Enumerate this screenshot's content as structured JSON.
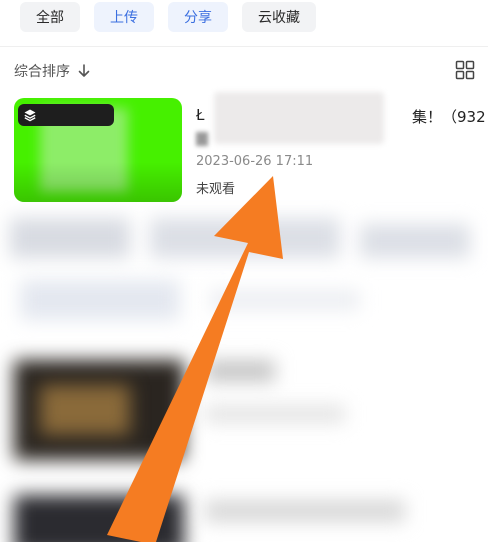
{
  "filters": [
    {
      "label": "全部",
      "active": false
    },
    {
      "label": "上传",
      "active": true
    },
    {
      "label": "分享",
      "active": true
    },
    {
      "label": "云收藏",
      "active": false
    }
  ],
  "sort": {
    "label": "综合排序"
  },
  "item": {
    "title_start": "Ł",
    "title_end": "集！（932",
    "date": "2023-06-26 17:11",
    "status": "未观看",
    "thumb_color": "#46f000"
  },
  "colors": {
    "accent": "#3b6fe0",
    "arrow": "#f57c22"
  },
  "icons": {
    "sort": "arrow-down-icon",
    "view": "grid-view-icon",
    "stack": "layers-icon"
  }
}
